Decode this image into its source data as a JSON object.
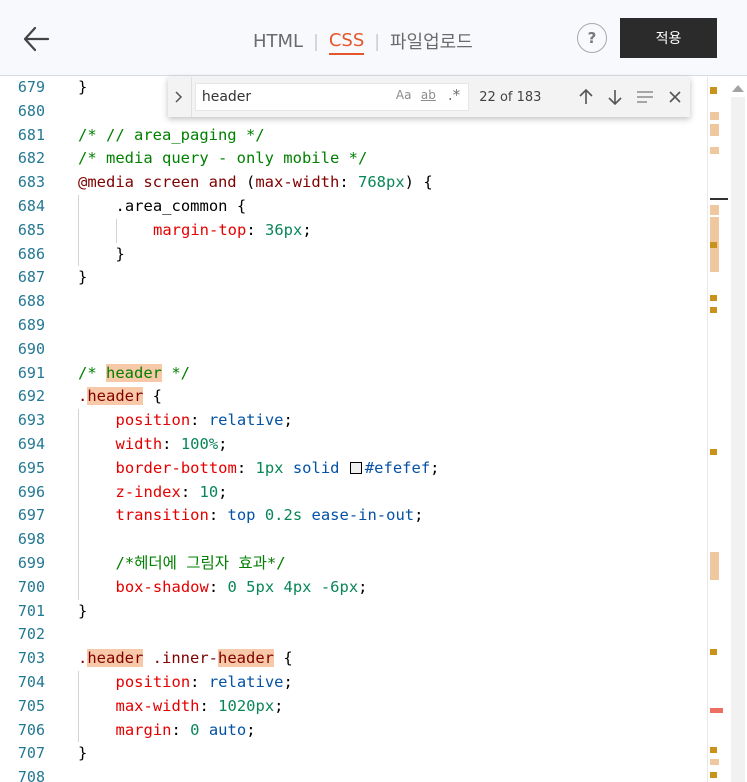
{
  "header": {
    "back_icon": "arrow-left-icon",
    "tabs": [
      {
        "label": "HTML",
        "active": false
      },
      {
        "label": "CSS",
        "active": true
      },
      {
        "label": "파일업로드",
        "active": false
      }
    ],
    "help_label": "?",
    "apply_label": "적용"
  },
  "find": {
    "query": "header",
    "match_case_label": "Aa",
    "whole_word_label": "ab",
    "regex_label": ".*",
    "count": "22 of 183"
  },
  "colors": {
    "accent": "#e4562b",
    "comment": "#008000",
    "property": "#e50000",
    "value": "#0451a5",
    "number": "#098658",
    "selector": "#800000",
    "line_number": "#237893",
    "match_highlight": "#f8c9a8"
  },
  "lines": [
    {
      "n": "679",
      "indent": 0,
      "tokens": [
        {
          "t": "}",
          "c": "plain"
        }
      ]
    },
    {
      "n": "680",
      "indent": 0,
      "tokens": []
    },
    {
      "n": "681",
      "indent": 0,
      "tokens": [
        {
          "t": "/* // area_paging */",
          "c": "comment"
        }
      ]
    },
    {
      "n": "682",
      "indent": 0,
      "tokens": [
        {
          "t": "/* media query - only mobile */",
          "c": "comment"
        }
      ]
    },
    {
      "n": "683",
      "indent": 0,
      "tokens": [
        {
          "t": "@media screen and ",
          "c": "sel"
        },
        {
          "t": "(",
          "c": "plain"
        },
        {
          "t": "max-width",
          "c": "sel"
        },
        {
          "t": ": ",
          "c": "plain"
        },
        {
          "t": "768px",
          "c": "num"
        },
        {
          "t": ") {",
          "c": "plain"
        }
      ]
    },
    {
      "n": "684",
      "indent": 1,
      "tokens": [
        {
          "t": ".area_common {",
          "c": "plain"
        }
      ]
    },
    {
      "n": "685",
      "indent": 2,
      "tokens": [
        {
          "t": "margin-top",
          "c": "prop"
        },
        {
          "t": ": ",
          "c": "plain"
        },
        {
          "t": "36px",
          "c": "num"
        },
        {
          "t": ";",
          "c": "plain"
        }
      ]
    },
    {
      "n": "686",
      "indent": 1,
      "tokens": [
        {
          "t": "}",
          "c": "plain"
        }
      ]
    },
    {
      "n": "687",
      "indent": 0,
      "tokens": [
        {
          "t": "}",
          "c": "plain"
        }
      ]
    },
    {
      "n": "688",
      "indent": 0,
      "tokens": []
    },
    {
      "n": "689",
      "indent": 0,
      "tokens": []
    },
    {
      "n": "690",
      "indent": 0,
      "tokens": []
    },
    {
      "n": "691",
      "indent": 0,
      "tokens": [
        {
          "t": "/* ",
          "c": "comment"
        },
        {
          "t": "header",
          "c": "comment",
          "hl": true
        },
        {
          "t": " */",
          "c": "comment"
        }
      ]
    },
    {
      "n": "692",
      "indent": 0,
      "tokens": [
        {
          "t": ".",
          "c": "sel"
        },
        {
          "t": "header",
          "c": "sel",
          "hl": true
        },
        {
          "t": " {",
          "c": "plain"
        }
      ]
    },
    {
      "n": "693",
      "indent": 1,
      "tokens": [
        {
          "t": "position",
          "c": "prop"
        },
        {
          "t": ": ",
          "c": "plain"
        },
        {
          "t": "relative",
          "c": "val"
        },
        {
          "t": ";",
          "c": "plain"
        }
      ]
    },
    {
      "n": "694",
      "indent": 1,
      "tokens": [
        {
          "t": "width",
          "c": "prop"
        },
        {
          "t": ": ",
          "c": "plain"
        },
        {
          "t": "100%",
          "c": "num"
        },
        {
          "t": ";",
          "c": "plain"
        }
      ]
    },
    {
      "n": "695",
      "indent": 1,
      "tokens": [
        {
          "t": "border-bottom",
          "c": "prop"
        },
        {
          "t": ": ",
          "c": "plain"
        },
        {
          "t": "1px",
          "c": "num"
        },
        {
          "t": " solid ",
          "c": "val"
        },
        {
          "t": "",
          "c": "swatch"
        },
        {
          "t": "#efefef",
          "c": "val"
        },
        {
          "t": ";",
          "c": "plain"
        }
      ]
    },
    {
      "n": "696",
      "indent": 1,
      "tokens": [
        {
          "t": "z-index",
          "c": "prop"
        },
        {
          "t": ": ",
          "c": "plain"
        },
        {
          "t": "10",
          "c": "num"
        },
        {
          "t": ";",
          "c": "plain"
        }
      ]
    },
    {
      "n": "697",
      "indent": 1,
      "tokens": [
        {
          "t": "transition",
          "c": "prop"
        },
        {
          "t": ": ",
          "c": "plain"
        },
        {
          "t": "top ",
          "c": "val"
        },
        {
          "t": "0.2s",
          "c": "num"
        },
        {
          "t": " ease-in-out",
          "c": "val"
        },
        {
          "t": ";",
          "c": "plain"
        }
      ]
    },
    {
      "n": "698",
      "indent": 1,
      "tokens": []
    },
    {
      "n": "699",
      "indent": 1,
      "tokens": [
        {
          "t": "/*헤더에 그림자 효과*/",
          "c": "comment"
        }
      ]
    },
    {
      "n": "700",
      "indent": 1,
      "tokens": [
        {
          "t": "box-shadow",
          "c": "prop"
        },
        {
          "t": ": ",
          "c": "plain"
        },
        {
          "t": "0 5px 4px -6px",
          "c": "num"
        },
        {
          "t": ";",
          "c": "plain"
        }
      ]
    },
    {
      "n": "701",
      "indent": 0,
      "tokens": [
        {
          "t": "}",
          "c": "plain"
        }
      ]
    },
    {
      "n": "702",
      "indent": 0,
      "tokens": []
    },
    {
      "n": "703",
      "indent": 0,
      "tokens": [
        {
          "t": ".",
          "c": "sel"
        },
        {
          "t": "header",
          "c": "sel",
          "hl": true
        },
        {
          "t": " .inner-",
          "c": "sel"
        },
        {
          "t": "header",
          "c": "sel",
          "hl": true
        },
        {
          "t": " {",
          "c": "plain"
        }
      ]
    },
    {
      "n": "704",
      "indent": 1,
      "tokens": [
        {
          "t": "position",
          "c": "prop"
        },
        {
          "t": ": ",
          "c": "plain"
        },
        {
          "t": "relative",
          "c": "val"
        },
        {
          "t": ";",
          "c": "plain"
        }
      ]
    },
    {
      "n": "705",
      "indent": 1,
      "tokens": [
        {
          "t": "max-width",
          "c": "prop"
        },
        {
          "t": ": ",
          "c": "plain"
        },
        {
          "t": "1020px",
          "c": "num"
        },
        {
          "t": ";",
          "c": "plain"
        }
      ]
    },
    {
      "n": "706",
      "indent": 1,
      "tokens": [
        {
          "t": "margin",
          "c": "prop"
        },
        {
          "t": ": ",
          "c": "plain"
        },
        {
          "t": "0",
          "c": "num"
        },
        {
          "t": " auto",
          "c": "val"
        },
        {
          "t": ";",
          "c": "plain"
        }
      ]
    },
    {
      "n": "707",
      "indent": 0,
      "tokens": [
        {
          "t": "}",
          "c": "plain"
        }
      ]
    },
    {
      "n": "708",
      "indent": 0,
      "tokens": []
    }
  ]
}
